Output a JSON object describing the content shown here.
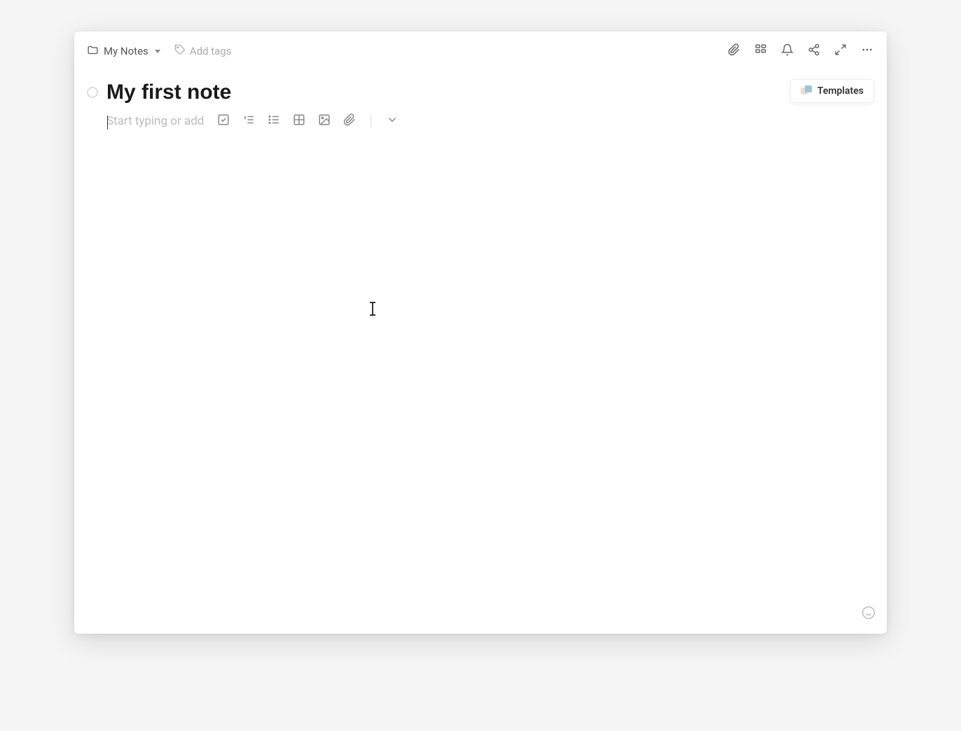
{
  "header": {
    "folder_name": "My Notes",
    "add_tags_label": "Add tags"
  },
  "note": {
    "title": "My first note",
    "placeholder": "Start typing or add"
  },
  "templates": {
    "label": "Templates"
  },
  "icons": {
    "folder": "folder",
    "tag": "tag",
    "attach": "paperclip",
    "widgets": "widgets",
    "reminder": "bell",
    "share": "share",
    "expand": "expand",
    "more": "more",
    "checkbox": "checkbox",
    "numbered_list": "numbered-list",
    "bullet_list": "bullet-list",
    "table": "table",
    "image": "image",
    "attachment": "attachment",
    "chevron": "chevron-down",
    "emoji": "emoji"
  }
}
